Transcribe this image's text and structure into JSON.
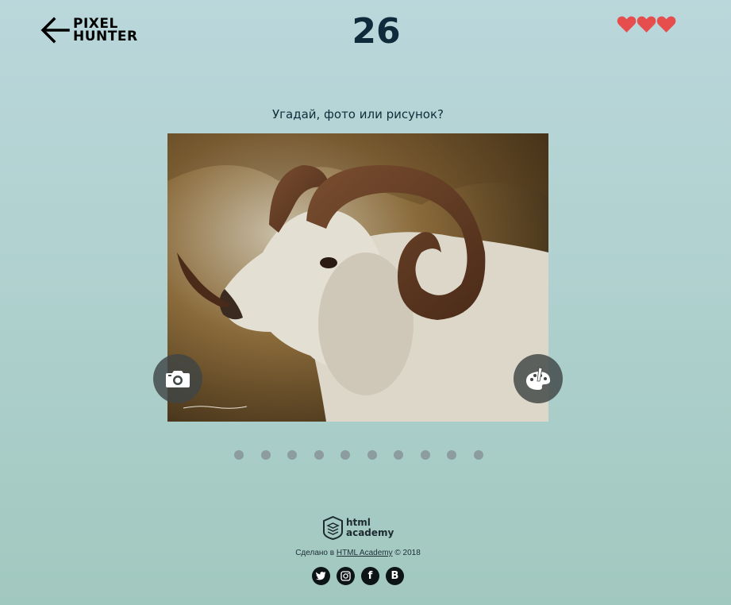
{
  "header": {
    "back_icon": "arrow-left-icon",
    "logo_line1": "PIXEL",
    "logo_line2": "HUNTER",
    "timer": "26",
    "lives": 3,
    "heart_color": "#e64e4e"
  },
  "game": {
    "task": "Угадай, фото или рисунок?",
    "photo_button_icon": "camera-icon",
    "paint_button_icon": "palette-icon"
  },
  "stats": {
    "dots": 10
  },
  "footer": {
    "academy_line1": "html",
    "academy_line2": "academy",
    "made_in": "Сделано в ",
    "academy_link": "HTML Academy",
    "copyright": " © 2018",
    "social": [
      {
        "name": "twitter",
        "label": ""
      },
      {
        "name": "instagram",
        "label": ""
      },
      {
        "name": "facebook",
        "label": "f"
      },
      {
        "name": "vk",
        "label": "B"
      }
    ]
  }
}
